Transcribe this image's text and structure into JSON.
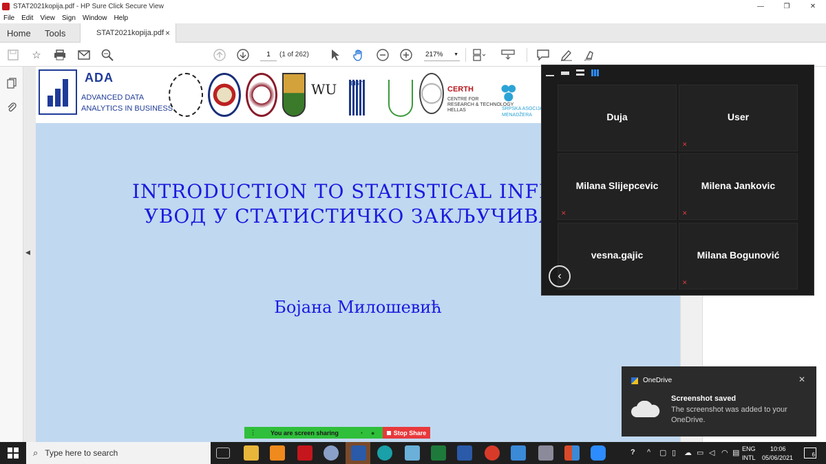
{
  "window": {
    "title": "STAT2021kopija.pdf - HP Sure Click Secure View",
    "minimize": "—",
    "restore": "❐",
    "close": "✕"
  },
  "menu": [
    "File",
    "Edit",
    "View",
    "Sign",
    "Window",
    "Help"
  ],
  "tabs": {
    "home": "Home",
    "tools": "Tools",
    "file": "STAT2021kopija.pdf",
    "close": "×"
  },
  "toolbar": {
    "page_current": "1",
    "page_count": "(1 of 262)",
    "zoom": "217%"
  },
  "document": {
    "ada_title": "ADA",
    "ada_sub1": "ADVANCED DATA",
    "ada_sub2": "ANALYTICS IN BUSINESS",
    "logo_wu": "WU",
    "logo_eisti": "EISTI",
    "logo_certh": "CERTH",
    "logo_certh_sub1": "CENTRE FOR",
    "logo_certh_sub2": "RESEARCH & TECHNOLOGY",
    "logo_certh_sub3": "HELLAS",
    "logo_sam1": "SRPSKA ASOCIJACIJA",
    "logo_sam2": "MENADŽERA",
    "title_line1": "INTRODUCTION TO STATISTICAL INFERE",
    "title_line2": "УВОД У СТАТИСТИЧКО ЗАКЉУЧИВАН",
    "author": "Бојана Милошевић"
  },
  "meeting": {
    "participants": [
      "Duja",
      "User",
      "Milana Slijepcevic",
      "Milena Jankovic",
      "vesna.gajic",
      "Milana Bogunović"
    ]
  },
  "share_bar": {
    "status": "You are screen sharing",
    "stop": "Stop Share"
  },
  "toast": {
    "app": "OneDrive",
    "title": "Screenshot saved",
    "body": "The screenshot was added to your OneDrive."
  },
  "taskbar": {
    "search_placeholder": "Type here to search",
    "lang1": "ENG",
    "lang2": "INTL",
    "time": "10:06",
    "date": "05/06/2021",
    "notifications": "6"
  },
  "colors": {
    "slide_bg": "#c0d8f0",
    "slide_text": "#1a1ae0",
    "ada_blue": "#1f3b99",
    "share_green": "#2fbf3a",
    "share_red": "#e8393b"
  }
}
